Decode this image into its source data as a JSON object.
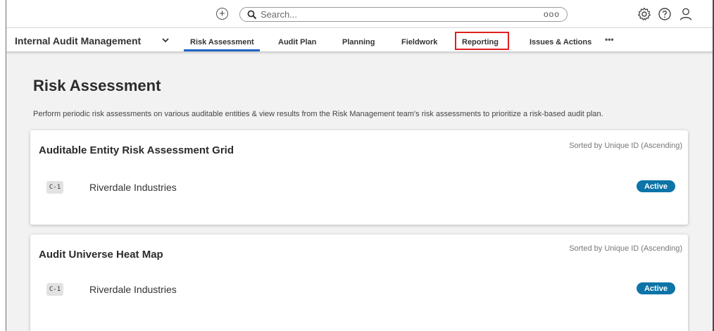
{
  "topbar": {
    "add_icon": "plus-circle-icon",
    "search_placeholder": "Search...",
    "search_more": "ooo",
    "settings_icon": "gear-icon",
    "help_icon": "question-circle-icon",
    "profile_icon": "user-icon"
  },
  "nav": {
    "app_title": "Internal Audit Management",
    "tabs": [
      {
        "label": "Risk Assessment",
        "active": true
      },
      {
        "label": "Audit Plan"
      },
      {
        "label": "Planning"
      },
      {
        "label": "Fieldwork"
      },
      {
        "label": "Reporting",
        "highlighted": true
      },
      {
        "label": "Issues & Actions"
      }
    ],
    "more": "•••",
    "active_color": "#1f63c6",
    "highlight_color": "#e02020"
  },
  "page": {
    "title": "Risk Assessment",
    "description": "Perform periodic risk assessments on various auditable entities & view results from the Risk Management team's risk assessments to prioritize a risk-based audit plan."
  },
  "cards": [
    {
      "title": "Auditable Entity Risk Assessment Grid",
      "sort": "Sorted by Unique ID (Ascending)",
      "rows": [
        {
          "uid": "C-1",
          "name": "Riverdale Industries",
          "status": "Active"
        }
      ]
    },
    {
      "title": "Audit Universe Heat Map",
      "sort": "Sorted by Unique ID (Ascending)",
      "rows": [
        {
          "uid": "C-1",
          "name": "Riverdale Industries",
          "status": "Active"
        }
      ]
    }
  ],
  "colors": {
    "status_active": "#0d74a8",
    "background": "#f2f2f2"
  }
}
